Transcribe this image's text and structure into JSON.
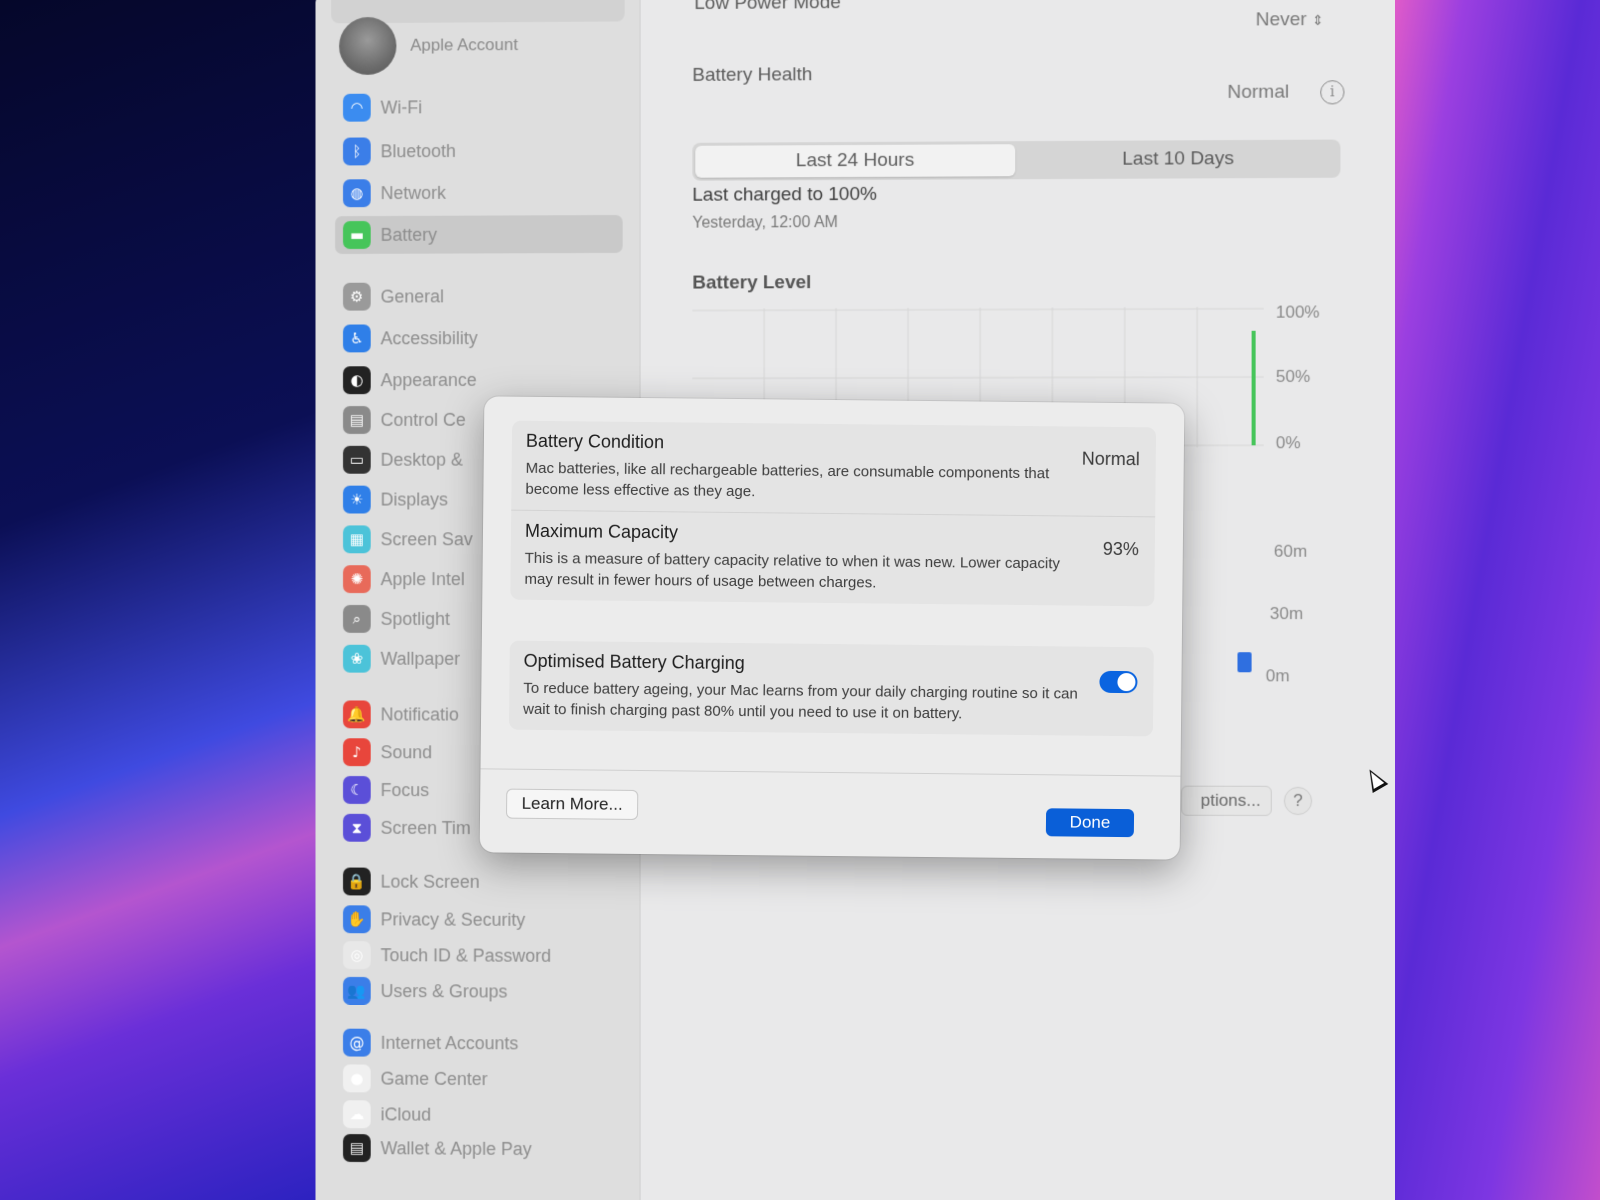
{
  "sidebar": {
    "account_label": "Apple Account",
    "items": [
      {
        "label": "Wi-Fi",
        "icon": "wifi-icon",
        "color": "#3b8cf0",
        "glyph": "◠"
      },
      {
        "label": "Bluetooth",
        "icon": "bluetooth-icon",
        "color": "#3b7ee8",
        "glyph": "ᛒ"
      },
      {
        "label": "Network",
        "icon": "network-icon",
        "color": "#3b7ee8",
        "glyph": "◍"
      },
      {
        "label": "Battery",
        "icon": "battery-icon",
        "color": "#46c55a",
        "glyph": "▬"
      },
      {
        "label": "General",
        "icon": "gear-icon",
        "color": "#9a9a9a",
        "glyph": "⚙"
      },
      {
        "label": "Accessibility",
        "icon": "accessibility-icon",
        "color": "#2f7fe8",
        "glyph": "♿"
      },
      {
        "label": "Appearance",
        "icon": "appearance-icon",
        "color": "#222222",
        "glyph": "◐"
      },
      {
        "label": "Control Ce",
        "icon": "control-centre-icon",
        "color": "#8a8a8a",
        "glyph": "▤"
      },
      {
        "label": "Desktop &",
        "icon": "desktop-dock-icon",
        "color": "#333333",
        "glyph": "▭"
      },
      {
        "label": "Displays",
        "icon": "displays-icon",
        "color": "#2f7fe8",
        "glyph": "☀"
      },
      {
        "label": "Screen Sav",
        "icon": "screen-saver-icon",
        "color": "#4cc3d9",
        "glyph": "▦"
      },
      {
        "label": "Apple Intel",
        "icon": "apple-intelligence-icon",
        "color": "#e86a5a",
        "glyph": "✺"
      },
      {
        "label": "Spotlight",
        "icon": "spotlight-icon",
        "color": "#8a8a8a",
        "glyph": "⌕"
      },
      {
        "label": "Wallpaper",
        "icon": "wallpaper-icon",
        "color": "#4cc3d9",
        "glyph": "❀"
      },
      {
        "label": "Notificatio",
        "icon": "notifications-icon",
        "color": "#e8463c",
        "glyph": "🔔"
      },
      {
        "label": "Sound",
        "icon": "sound-icon",
        "color": "#e8463c",
        "glyph": "♪"
      },
      {
        "label": "Focus",
        "icon": "focus-icon",
        "color": "#5b4fd8",
        "glyph": "☾"
      },
      {
        "label": "Screen Tim",
        "icon": "screen-time-icon",
        "color": "#5b4fd8",
        "glyph": "⧗"
      },
      {
        "label": "Lock Screen",
        "icon": "lock-icon",
        "color": "#222222",
        "glyph": "🔒"
      },
      {
        "label": "Privacy & Security",
        "icon": "privacy-hand-icon",
        "color": "#3b7ee8",
        "glyph": "✋"
      },
      {
        "label": "Touch ID & Password",
        "icon": "touch-id-icon",
        "color": "#e8e8e8",
        "glyph": "◎"
      },
      {
        "label": "Users & Groups",
        "icon": "users-icon",
        "color": "#3b7ee8",
        "glyph": "👥"
      },
      {
        "label": "Internet Accounts",
        "icon": "internet-accounts-icon",
        "color": "#3b7ee8",
        "glyph": "@"
      },
      {
        "label": "Game Center",
        "icon": "game-center-icon",
        "color": "#f0f0f0",
        "glyph": "●"
      },
      {
        "label": "iCloud",
        "icon": "icloud-icon",
        "color": "#f0f0f0",
        "glyph": "☁"
      },
      {
        "label": "Wallet & Apple Pay",
        "icon": "wallet-icon",
        "color": "#222222",
        "glyph": "▤"
      }
    ],
    "selected": "Battery"
  },
  "main": {
    "low_power_label": "Low Power Mode",
    "low_power_value": "Never",
    "battery_health_label": "Battery Health",
    "battery_health_value": "Normal",
    "tabs": [
      "Last 24 Hours",
      "Last 10 Days"
    ],
    "last_charged": "Last charged to 100%",
    "last_charged_time": "Yesterday, 12:00 AM",
    "battery_level_title": "Battery Level",
    "level_axis": [
      "100%",
      "50%",
      "0%"
    ],
    "usage_axis": [
      "60m",
      "30m",
      "0m"
    ],
    "options_label": "ptions...",
    "help_label": "?"
  },
  "dialog": {
    "rows": [
      {
        "title": "Battery Condition",
        "description": "Mac batteries, like all rechargeable batteries, are consumable components that become less effective as they age.",
        "value": "Normal"
      },
      {
        "title": "Maximum Capacity",
        "description": "This is a measure of battery capacity relative to when it was new. Lower capacity may result in fewer hours of usage between charges.",
        "value": "93%"
      }
    ],
    "optimised": {
      "title": "Optimised Battery Charging",
      "description": "To reduce battery ageing, your Mac learns from your daily charging routine so it can wait to finish charging past 80% until you need to use it on battery.",
      "enabled": true
    },
    "learn_more": "Learn More...",
    "done": "Done"
  },
  "colors": {
    "accent": "#0a5fd8",
    "battery_green": "#46c55a"
  }
}
